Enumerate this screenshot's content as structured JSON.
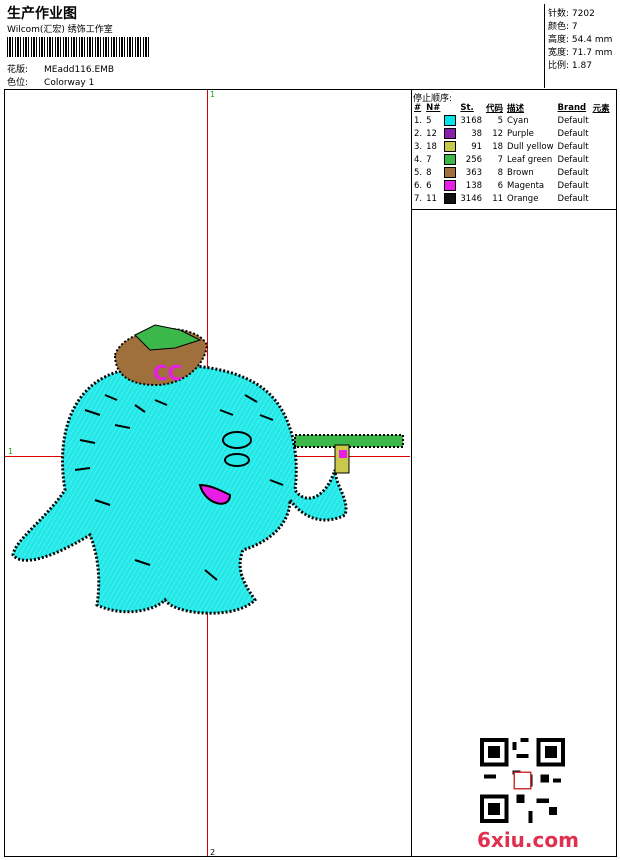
{
  "header": {
    "title": "生产作业图",
    "company": "Wilcom(汇宏) 绣饰工作室",
    "design_label": "花版:",
    "design_value": "MEadd116.EMB",
    "colorway_label": "色位:",
    "colorway_value": "Colorway 1"
  },
  "stats": [
    {
      "label": "针数:",
      "value": "7202"
    },
    {
      "label": "颜色:",
      "value": "7"
    },
    {
      "label": "高度:",
      "value": "54.4 mm"
    },
    {
      "label": "宽度:",
      "value": "71.7 mm"
    },
    {
      "label": "比例:",
      "value": "1.87"
    }
  ],
  "sequence": {
    "title": "停止顺序:",
    "headers": [
      "#",
      "N#",
      "St.",
      "代码",
      "描述",
      "Brand",
      "元素"
    ],
    "rows": [
      {
        "idx": "1.",
        "n": "5",
        "color": "#00E5E5",
        "st": "3168",
        "code": "5",
        "desc": "Cyan",
        "brand": "Default"
      },
      {
        "idx": "2.",
        "n": "12",
        "color": "#8B1FA8",
        "st": "38",
        "code": "12",
        "desc": "Purple",
        "brand": "Default"
      },
      {
        "idx": "3.",
        "n": "18",
        "color": "#C8C84A",
        "st": "91",
        "code": "18",
        "desc": "Dull yellow",
        "brand": "Default"
      },
      {
        "idx": "4.",
        "n": "7",
        "color": "#3CB84A",
        "st": "256",
        "code": "7",
        "desc": "Leaf green",
        "brand": "Default"
      },
      {
        "idx": "5.",
        "n": "8",
        "color": "#A0703C",
        "st": "363",
        "code": "8",
        "desc": "Brown",
        "brand": "Default"
      },
      {
        "idx": "6.",
        "n": "6",
        "color": "#E81EE8",
        "st": "138",
        "code": "6",
        "desc": "Magenta",
        "brand": "Default"
      },
      {
        "idx": "7.",
        "n": "11",
        "color": "#111111",
        "st": "3146",
        "code": "11",
        "desc": "Orange",
        "brand": "Default"
      }
    ]
  },
  "canvas": {
    "top_marker": "1",
    "bottom_marker": "2",
    "left_marker": "1",
    "crosshair_color": "#DD0000"
  },
  "watermark": {
    "text": "6xiu.com"
  }
}
